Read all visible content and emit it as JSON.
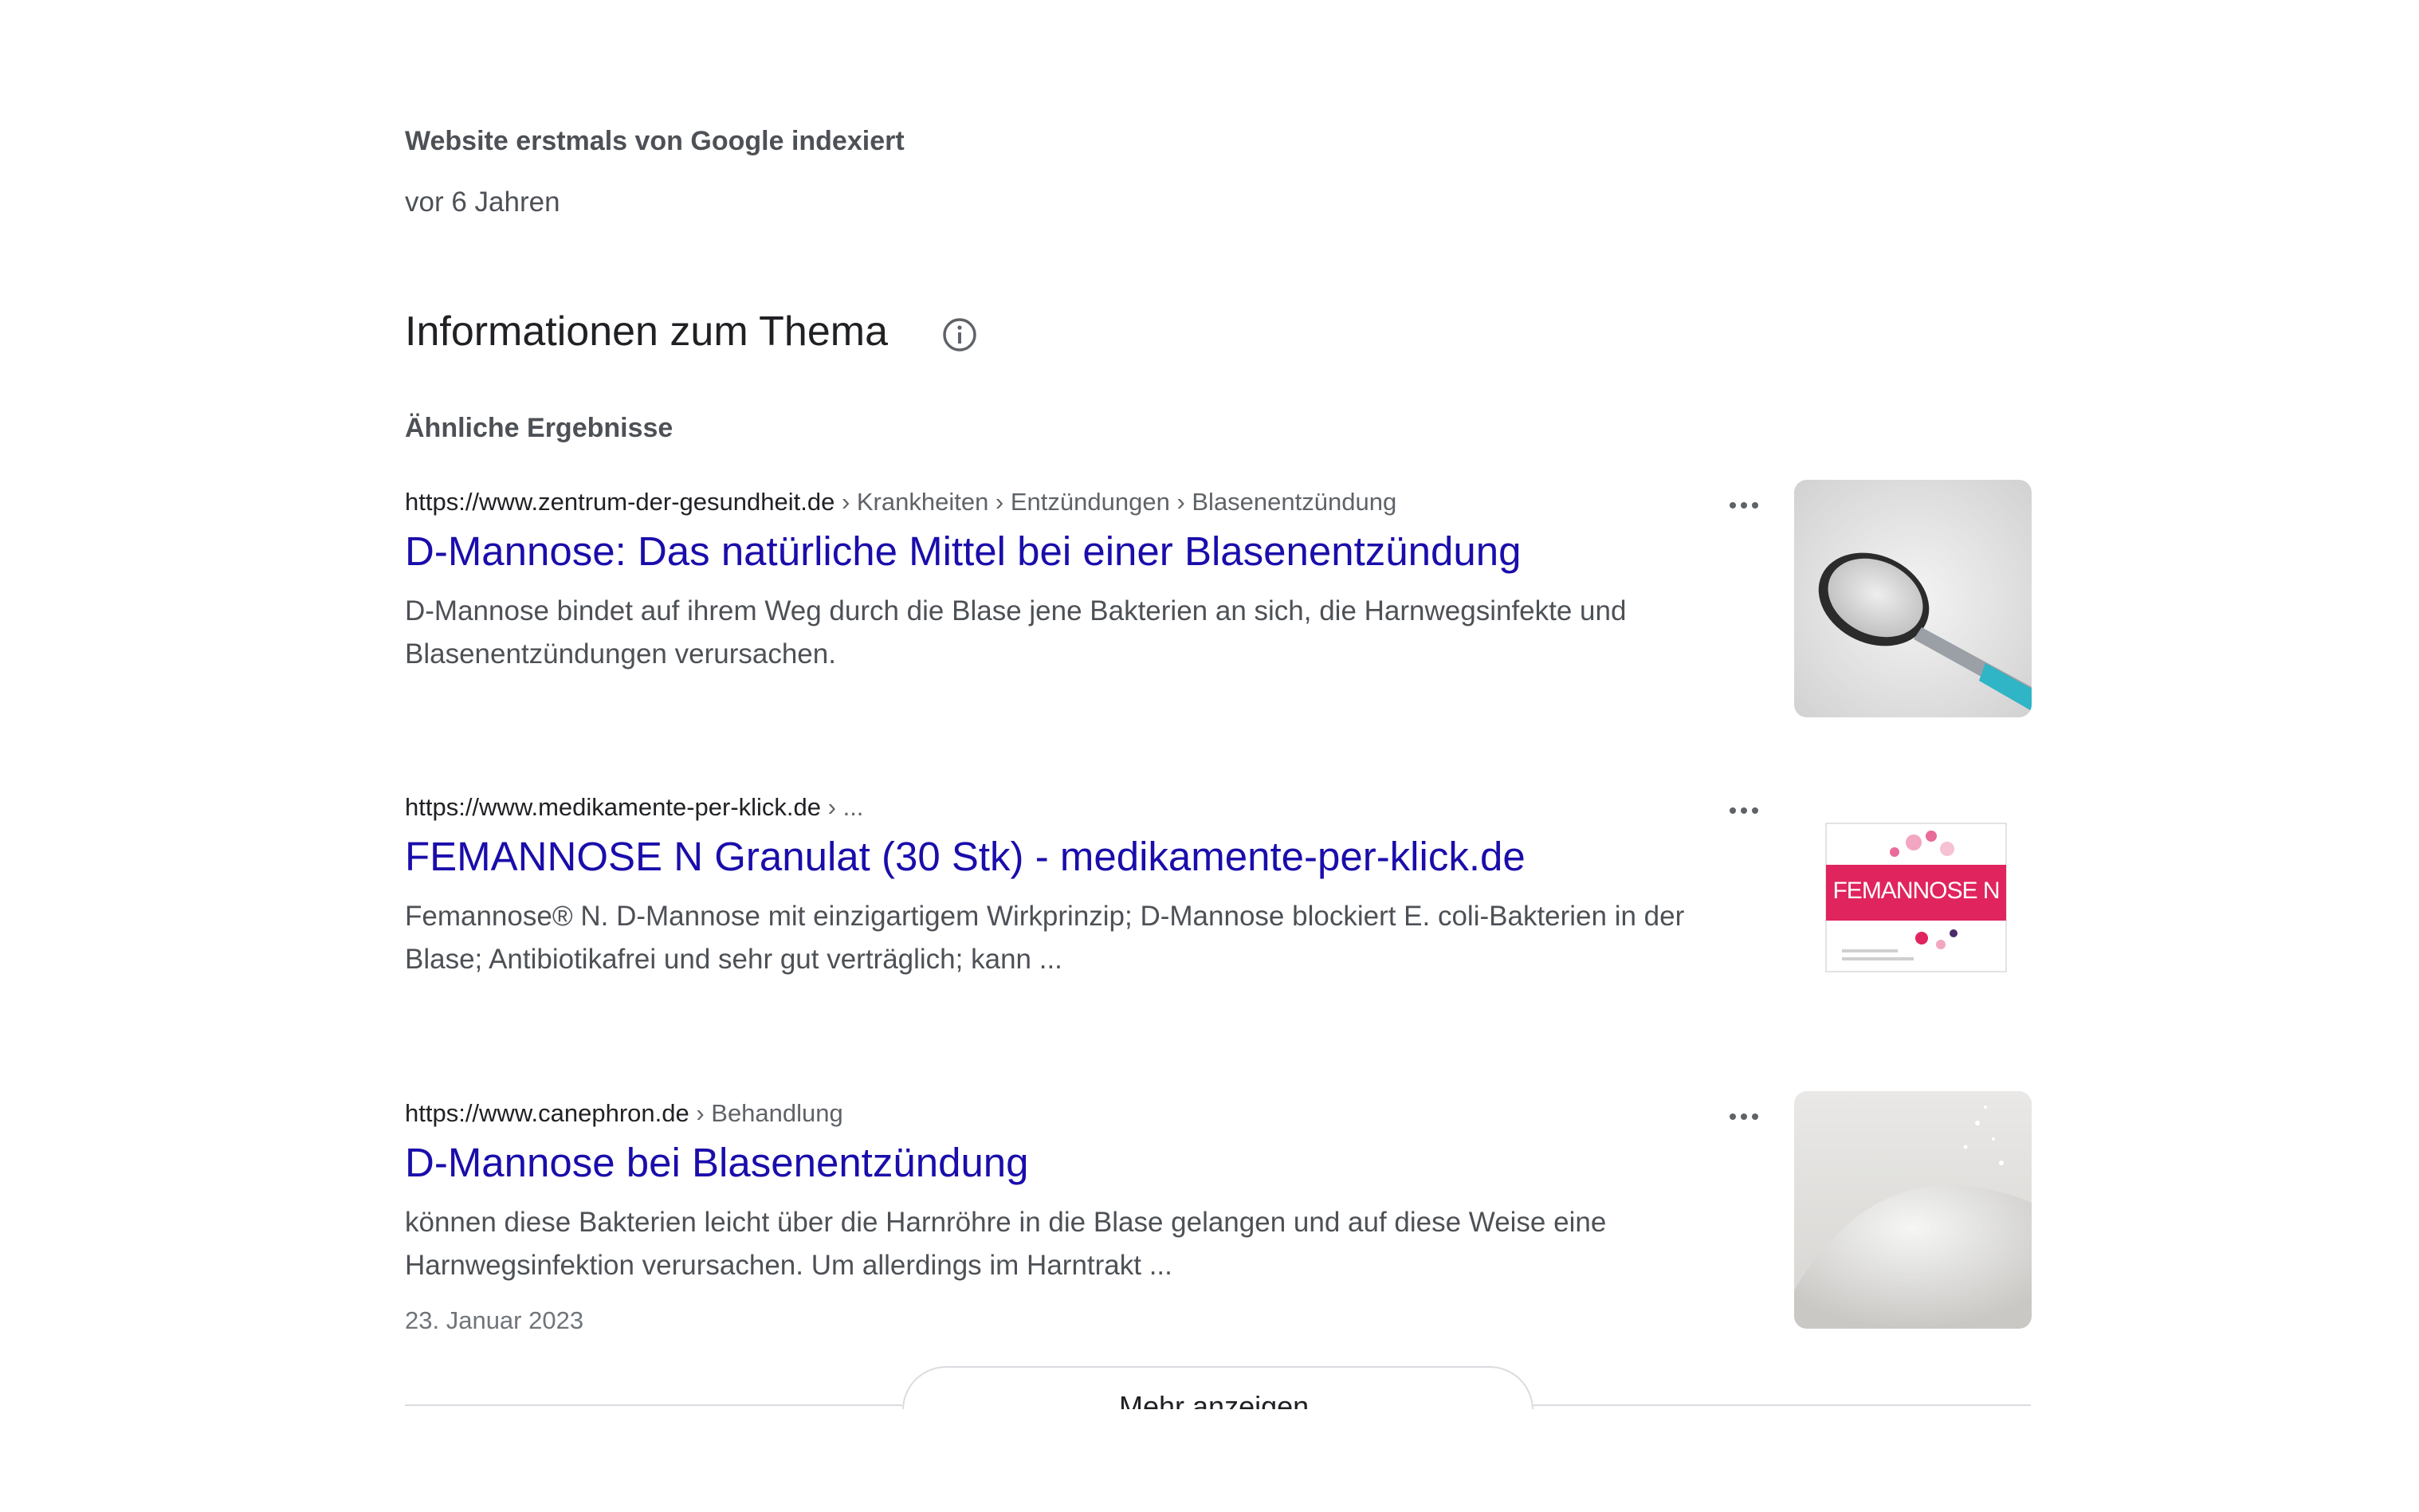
{
  "indexed": {
    "label": "Website erstmals von Google indexiert",
    "value": "vor 6 Jahren"
  },
  "section": {
    "title": "Informationen zum Thema",
    "info_icon": "info-circle-icon"
  },
  "similar": {
    "label": "Ähnliche Ergebnisse"
  },
  "results": [
    {
      "domain": "https://www.zentrum-der-gesundheit.de",
      "crumbs": " › Krankheiten › Entzündungen › Blasenentzündung",
      "title": "D-Mannose: Das natürliche Mittel bei einer Blasenentzündung",
      "snippet": "D-Mannose bindet auf ihrem Weg durch die Blase jene Bakterien an sich, die Harnwegsinfekte und Blasenentzündungen verursachen.",
      "date": "",
      "thumb": "sugar-spoon-image"
    },
    {
      "domain": "https://www.medikamente-per-klick.de",
      "crumbs": " › ...",
      "title": "FEMANNOSE N Granulat (30 Stk) - medikamente-per-klick.de",
      "snippet": "Femannose® N. D-Mannose mit einzigartigem Wirkprinzip; D-Mannose blockiert E. coli-Bakterien in der Blase; Antibiotikafrei und sehr gut verträglich; kann ...",
      "date": "",
      "thumb": "femannose-box-image",
      "thumb_text": "FEMANNOSE N"
    },
    {
      "domain": "https://www.canephron.de",
      "crumbs": " › Behandlung",
      "title": "D-Mannose bei Blasenentzündung",
      "snippet": "können diese Bakterien leicht über die Harnröhre in die Blase gelangen und auf diese Weise eine Harnwegsinfektion verursachen. Um allerdings im Harntrakt ...",
      "date": "23. Januar 2023",
      "thumb": "powder-pile-image"
    }
  ],
  "more_button": {
    "label": "Mehr anzeigen",
    "icon": "chevron-down-icon"
  },
  "colors": {
    "link": "#1a0dab",
    "text": "#202124",
    "secondary": "#4d5156",
    "border": "#dadce0"
  }
}
